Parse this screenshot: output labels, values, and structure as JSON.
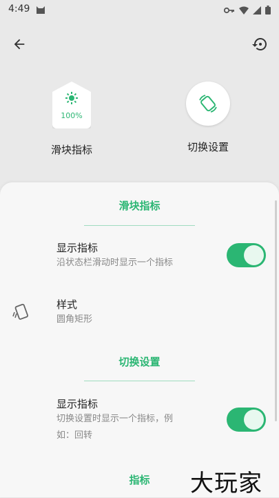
{
  "status_bar": {
    "time": "4:49",
    "left_icon": "cat-notification-icon",
    "right_icons": [
      "key-icon",
      "wifi-icon",
      "signal-icon",
      "battery-icon"
    ]
  },
  "toolbar": {
    "back_icon": "arrow-left-icon",
    "restore_icon": "restore-icon"
  },
  "options": {
    "slider": {
      "label": "滑块指标",
      "percent": "100%",
      "icon": "brightness-icon"
    },
    "switch": {
      "label": "切换设置",
      "icon": "screen-rotation-icon"
    }
  },
  "sheet": {
    "section1_title": "滑块指标",
    "row1": {
      "title": "显示指标",
      "subtitle": "沿状态栏滑动时显示一个指标",
      "enabled": true
    },
    "row2": {
      "title": "样式",
      "subtitle": "圆角矩形",
      "icon": "rounded-rect-style-icon"
    },
    "section2_title": "切换设置",
    "row3": {
      "title": "显示指标",
      "subtitle_line1": "切换设置时显示一个指标，例",
      "subtitle_line2": "如：回转",
      "enabled": true
    },
    "section3_title": "指标"
  },
  "watermark": "大玩家",
  "colors": {
    "accent": "#2bb673",
    "background": "#e9e9e9",
    "sheet": "#f7f7f7"
  }
}
